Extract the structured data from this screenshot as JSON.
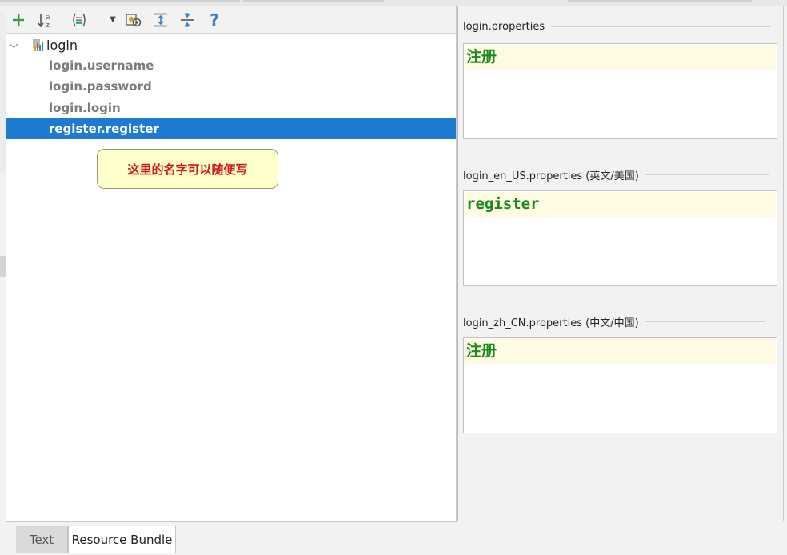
{
  "toolbar": {
    "buttons": [
      {
        "name": "add-property",
        "icon": "plus-icon",
        "glyph": "+"
      },
      {
        "name": "sort-alphabetically",
        "icon": "sort-az-icon",
        "glyph": "↓a"
      },
      {
        "name": "group-by-prefix",
        "icon": "group-icon",
        "glyph": "(≡)"
      },
      {
        "name": "dropdown",
        "icon": "dropdown-arrow-icon",
        "glyph": "▾"
      },
      {
        "name": "settings",
        "icon": "settings-gear-icon",
        "glyph": "⚙"
      },
      {
        "name": "expand-all",
        "icon": "expand-all-icon",
        "glyph": "⇕"
      },
      {
        "name": "collapse-all",
        "icon": "collapse-all-icon",
        "glyph": "≑"
      },
      {
        "name": "help",
        "icon": "help-icon",
        "glyph": "?"
      }
    ]
  },
  "tree": {
    "root": {
      "label": "login",
      "icon": "resource-bundle-icon",
      "expanded": true
    },
    "keys": [
      {
        "label": "login.username",
        "selected": false
      },
      {
        "label": "login.password",
        "selected": false
      },
      {
        "label": "login.login",
        "selected": false
      },
      {
        "label": "register.register",
        "selected": true
      }
    ]
  },
  "callout": {
    "text": "这里的名字可以随便写"
  },
  "properties": [
    {
      "title": "login.properties",
      "value": "注册"
    },
    {
      "title": "login_en_US.properties (英文/美国)",
      "value": "register"
    },
    {
      "title": "login_zh_CN.properties (中文/中国)",
      "value": "注册"
    }
  ],
  "bottom_tabs": [
    {
      "label": "Text",
      "active": false
    },
    {
      "label": "Resource Bundle",
      "active": true
    }
  ],
  "colors": {
    "selection": "#1f7bd1",
    "callout_bg": "#ffffcc",
    "callout_text": "#d11a1a",
    "value_text": "#1a8a1a",
    "value_line_bg": "#fffbe3",
    "add_icon": "#2e9e3e",
    "accent_icon": "#3b82c4"
  }
}
